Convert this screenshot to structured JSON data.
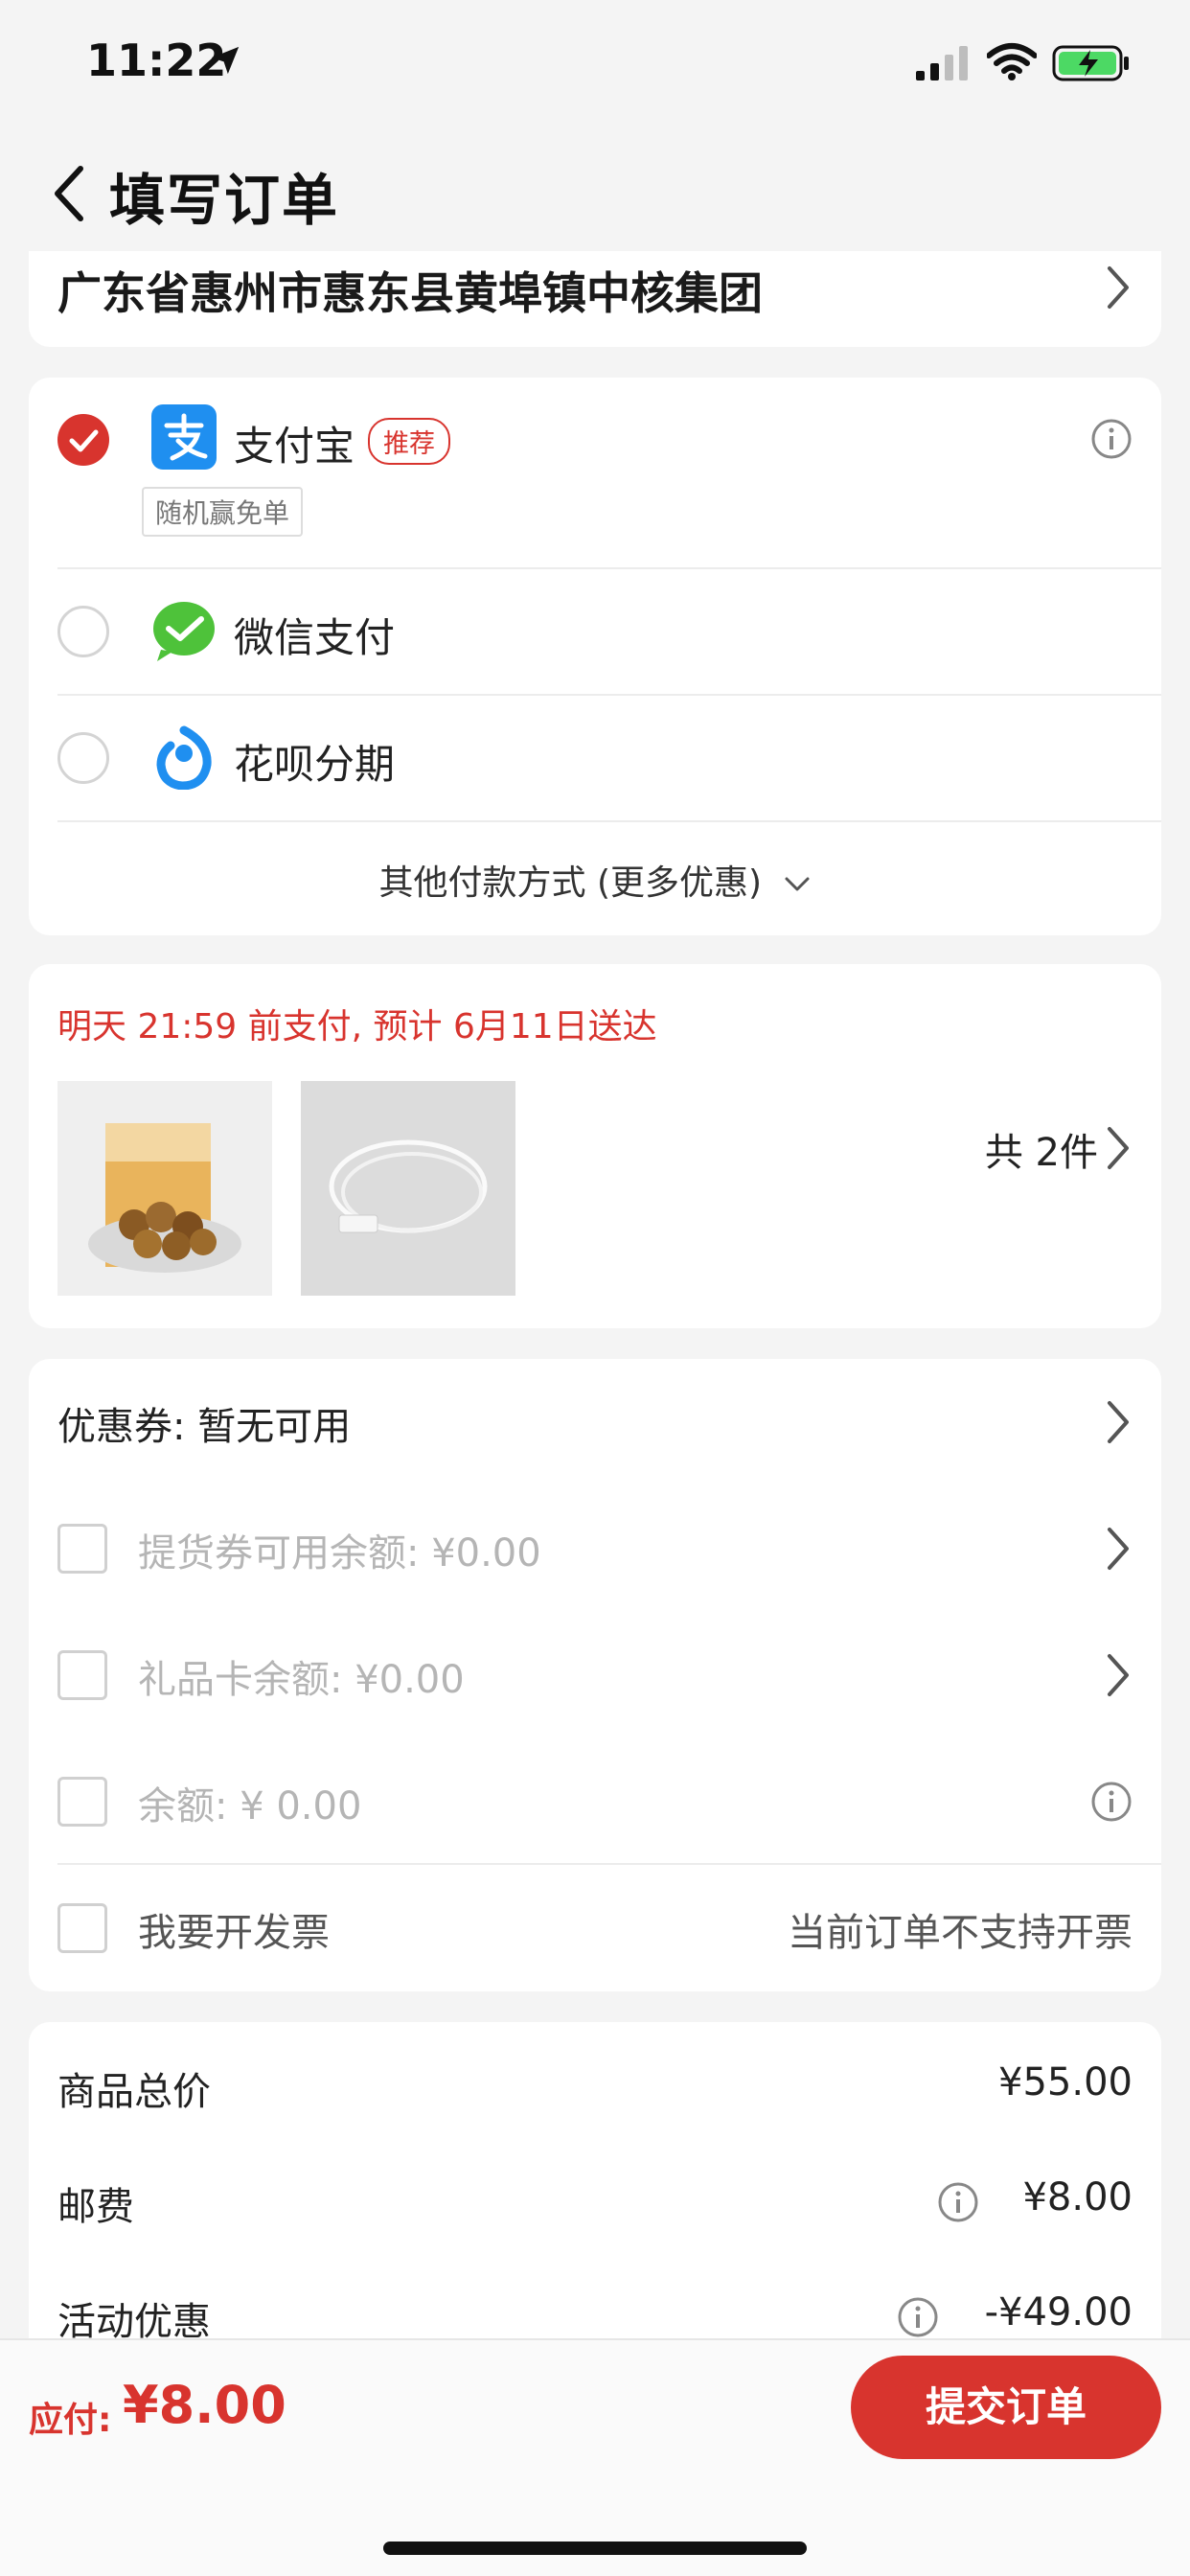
{
  "status_bar": {
    "time": "11:22"
  },
  "header": {
    "title": "填写订单"
  },
  "address": {
    "text": "广东省惠州市惠东县黄埠镇中核集团"
  },
  "payment": {
    "methods": [
      {
        "label": "支付宝",
        "badge": "推荐",
        "promo": "随机赢免单",
        "selected": true,
        "icon": "alipay-icon"
      },
      {
        "label": "微信支付",
        "selected": false,
        "icon": "wechat-pay-icon"
      },
      {
        "label": "花呗分期",
        "selected": false,
        "icon": "huabei-icon"
      }
    ],
    "other_label": "其他付款方式 (更多优惠)"
  },
  "delivery": {
    "notice": "明天 21:59 前支付, 预计 6月11日送达",
    "items": [
      "板栗仁",
      "USB数据线"
    ],
    "count_label": "共 2件"
  },
  "coupons": {
    "coupon_label": "优惠券:",
    "coupon_value": "暂无可用",
    "voucher_label": "提货券可用余额: ¥0.00",
    "giftcard_label": "礼品卡余额: ¥0.00",
    "balance_label": "余额: ¥ 0.00",
    "invoice_label": "我要开发票",
    "invoice_note": "当前订单不支持开票"
  },
  "summary": {
    "rows": [
      {
        "label": "商品总价",
        "value": "¥55.00"
      },
      {
        "label": "邮费",
        "value": "¥8.00"
      },
      {
        "label": "活动优惠",
        "value": "-¥49.00"
      }
    ]
  },
  "bottom": {
    "due_label": "应付:",
    "due_amount": "¥8.00",
    "submit_label": "提交订单"
  },
  "colors": {
    "accent": "#d8342e",
    "alipay": "#1f8ff0",
    "wechat": "#4ec23a"
  }
}
